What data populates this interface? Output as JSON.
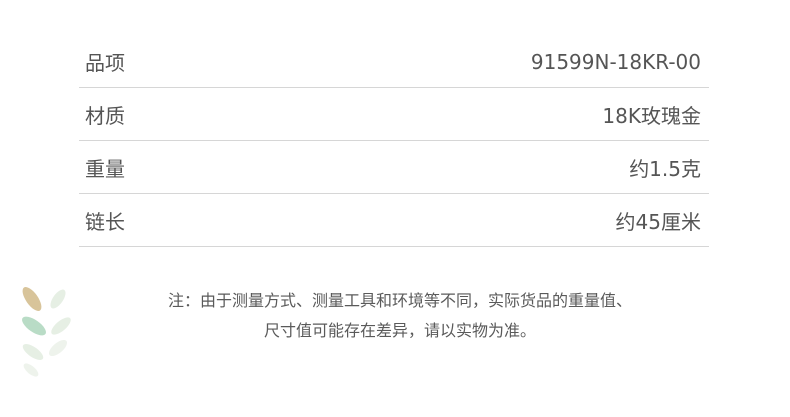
{
  "spec_rows": [
    {
      "label": "品项",
      "value": "91599N-18KR-00"
    },
    {
      "label": "材质",
      "value": "18K玫瑰金"
    },
    {
      "label": "重量",
      "value": "约1.5克"
    },
    {
      "label": "链长",
      "value": "约45厘米"
    }
  ],
  "note": {
    "line1": "注：由于测量方式、测量工具和环境等不同，实际货品的重量值、",
    "line2": "尺寸值可能存在差异，请以实物为准。"
  },
  "colors": {
    "leaf_tan": "#d8c49a",
    "leaf_green": "#b9dcc6",
    "leaf_light": "#e6efe4",
    "divider": "#d6d6d6"
  },
  "icons": {
    "decoration": "leaf-branch-icon"
  }
}
